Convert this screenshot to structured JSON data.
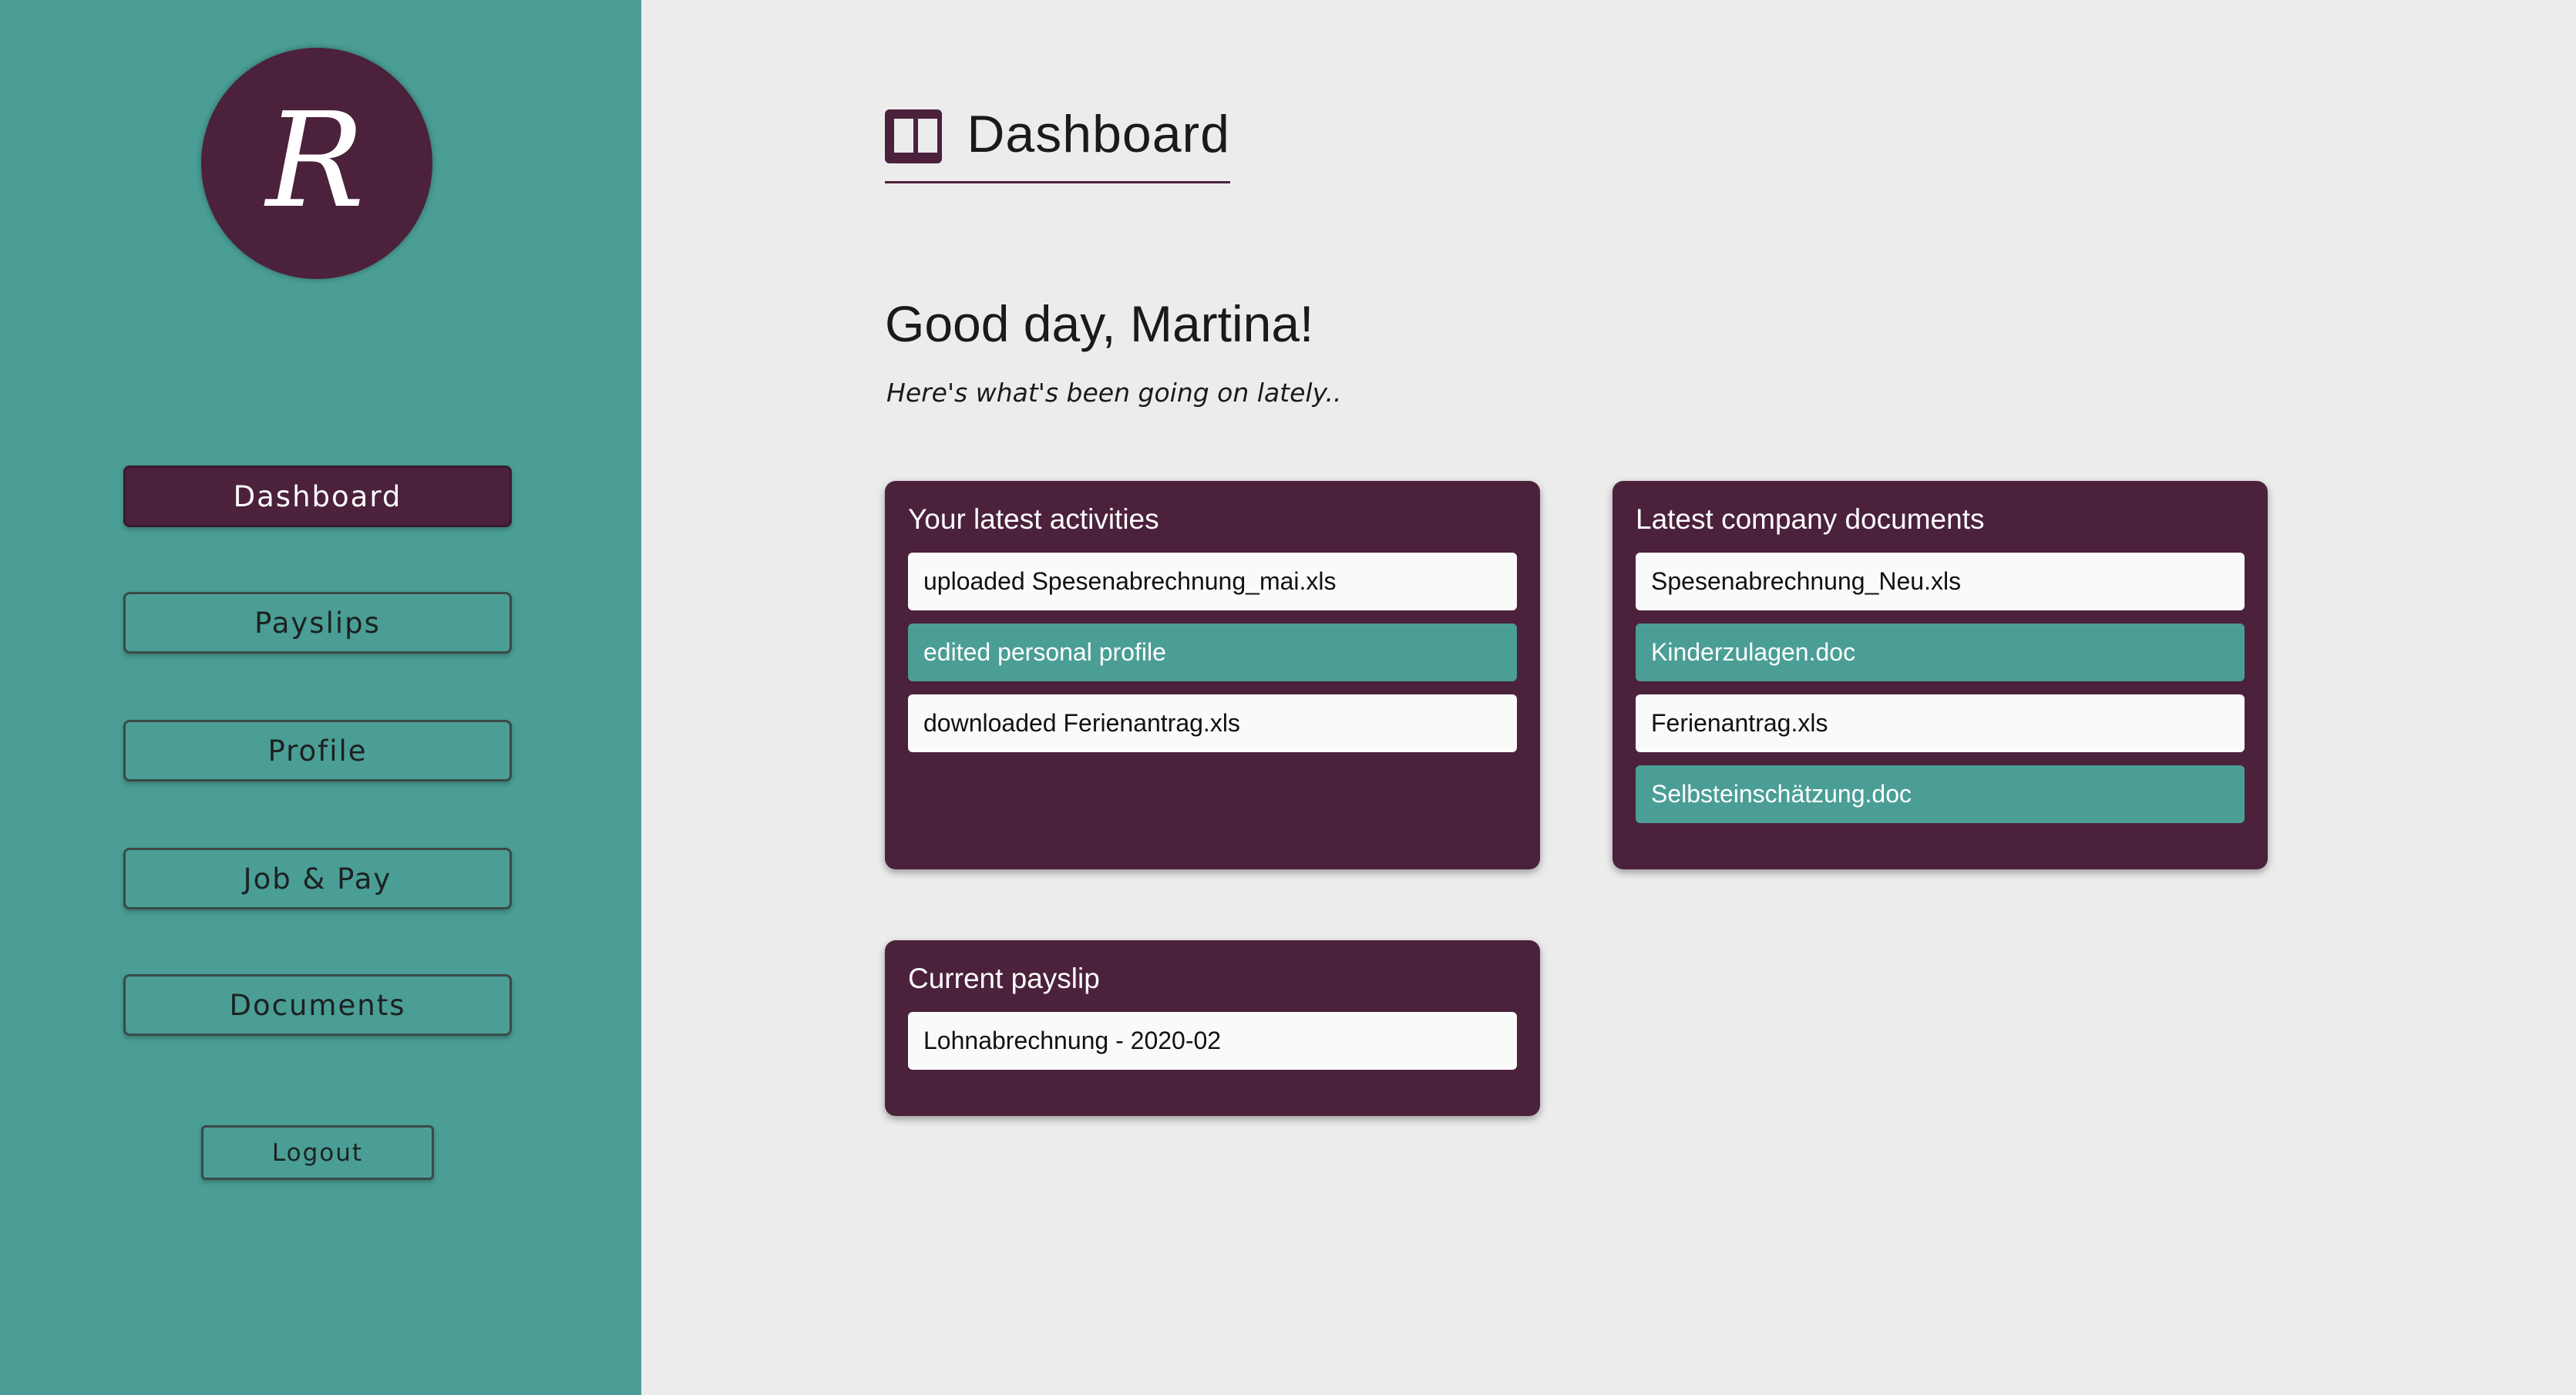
{
  "sidebar": {
    "logo_letter": "R",
    "nav": [
      {
        "label": "Dashboard",
        "active": true
      },
      {
        "label": "Payslips",
        "active": false
      },
      {
        "label": "Profile",
        "active": false
      },
      {
        "label": "Job & Pay",
        "active": false
      },
      {
        "label": "Documents",
        "active": false
      }
    ],
    "logout_label": "Logout"
  },
  "header": {
    "icon": "dashboard-icon",
    "title": "Dashboard"
  },
  "greeting": {
    "title": "Good day, Martina!",
    "subtitle": "Here's what's been going on lately.."
  },
  "cards": {
    "activities": {
      "title": "Your latest activities",
      "items": [
        "uploaded Spesenabrechnung_mai.xls",
        "edited personal profile",
        "downloaded Ferienantrag.xls"
      ]
    },
    "documents": {
      "title": "Latest company documents",
      "items": [
        "Spesenabrechnung_Neu.xls",
        "Kinderzulagen.doc",
        "Ferienantrag.xls",
        "Selbsteinschätzung.doc"
      ]
    },
    "payslip": {
      "title": "Current payslip",
      "items": [
        "Lohnabrechnung - 2020-02"
      ]
    }
  },
  "colors": {
    "accent": "#4b213b",
    "teal": "#4a9e95",
    "background": "#ececec",
    "item_light": "#fafafa"
  }
}
